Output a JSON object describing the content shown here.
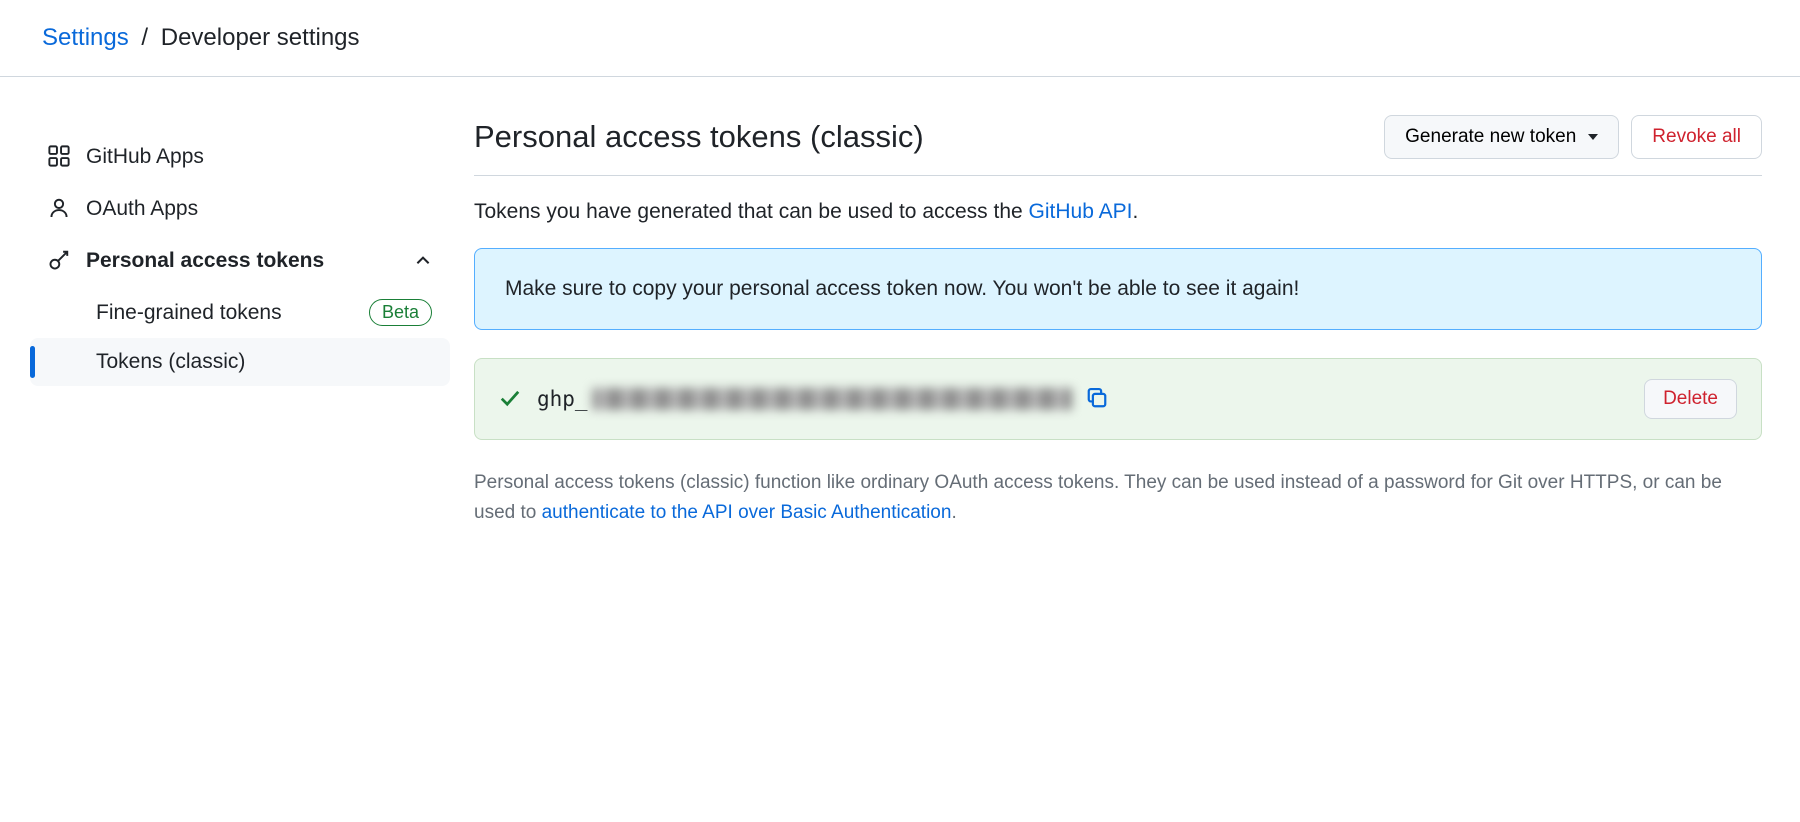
{
  "breadcrumb": {
    "root": "Settings",
    "current": "Developer settings"
  },
  "sidebar": {
    "github_apps": "GitHub Apps",
    "oauth_apps": "OAuth Apps",
    "pat": "Personal access tokens",
    "fine_grained": "Fine-grained tokens",
    "beta_label": "Beta",
    "tokens_classic": "Tokens (classic)"
  },
  "main": {
    "title": "Personal access tokens (classic)",
    "generate_btn": "Generate new token",
    "revoke_btn": "Revoke all",
    "description_pre": "Tokens you have generated that can be used to access the ",
    "description_link": "GitHub API",
    "description_post": ".",
    "flash_text": "Make sure to copy your personal access token now. You won't be able to see it again!",
    "token_prefix": "ghp_",
    "delete_btn": "Delete",
    "footnote_pre": "Personal access tokens (classic) function like ordinary OAuth access tokens. They can be used instead of a password for Git over HTTPS, or can be used to ",
    "footnote_link": "authenticate to the API over Basic Authentication",
    "footnote_post": "."
  }
}
